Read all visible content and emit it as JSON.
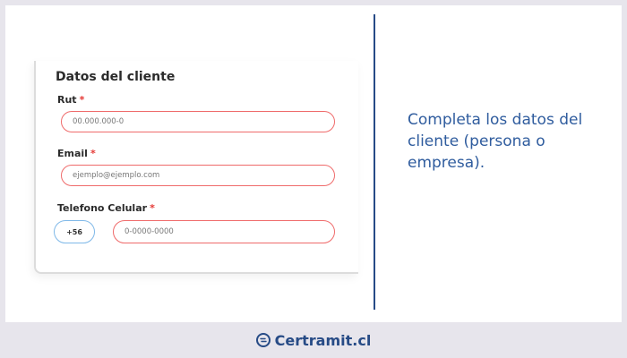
{
  "form": {
    "title": "Datos del cliente",
    "fields": [
      {
        "label": "Rut",
        "required_mark": "*",
        "placeholder": "00.000.000-0"
      },
      {
        "label": "Email",
        "required_mark": "*",
        "placeholder": "ejemplo@ejemplo.com"
      },
      {
        "label": "Telefono Celular",
        "required_mark": "*",
        "prefix": "+56",
        "placeholder": "0-0000-0000"
      }
    ]
  },
  "description": "Completa los datos del cliente (persona o empresa).",
  "footer": {
    "brand": "Certramit.cl",
    "icon": "certramit-logo-icon"
  },
  "colors": {
    "accent": "#274b86",
    "description_text": "#2f5c9e",
    "field_border": "#ef6b6b",
    "prefix_border": "#7fb8e8",
    "required": "#e53935",
    "background": "#e7e5ec"
  }
}
